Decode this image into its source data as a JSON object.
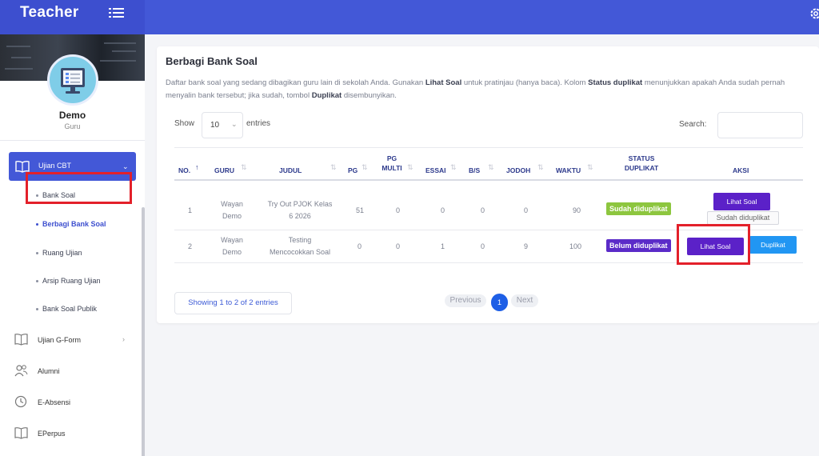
{
  "app": {
    "title": "Teacher"
  },
  "profile": {
    "name": "Demo",
    "role": "Guru"
  },
  "sidebar": {
    "active_menu": {
      "label": "Ujian CBT",
      "icon": "book-open-icon"
    },
    "submenu": [
      {
        "label": "Bank Soal"
      },
      {
        "label": "Berbagi Bank Soal"
      },
      {
        "label": "Ruang Ujian"
      },
      {
        "label": "Arsip Ruang Ujian"
      },
      {
        "label": "Bank Soal Publik"
      }
    ],
    "menu": [
      {
        "label": "Ujian G-Form",
        "icon": "book-icon"
      },
      {
        "label": "Alumni",
        "icon": "users-icon"
      },
      {
        "label": "E-Absensi",
        "icon": "clock-icon"
      },
      {
        "label": "EPerpus",
        "icon": "book-icon"
      }
    ]
  },
  "page": {
    "title": "Berbagi Bank Soal",
    "desc": {
      "p1": "Daftar bank soal yang sedang dibagikan guru lain di sekolah Anda. Gunakan ",
      "b1": "Lihat Soal",
      "p2": " untuk pratinjau (hanya baca). Kolom ",
      "b2": "Status duplikat",
      "p3": " menunjukkan apakah Anda sudah pernah menyalin bank tersebut; jika sudah, tombol ",
      "b3": "Duplikat",
      "p4": " disembunyikan."
    }
  },
  "table_controls": {
    "show_label": "Show",
    "show_value": "10",
    "entries_label": "entries",
    "search_label": "Search:"
  },
  "table": {
    "headers": {
      "no": "NO.",
      "guru": "GURU",
      "judul": "JUDUL",
      "pg": "PG",
      "pg_multi_1": "PG",
      "pg_multi_2": "MULTI",
      "essai": "ESSAI",
      "bs": "B/S",
      "jodoh": "JODOH",
      "waktu": "WAKTU",
      "status_1": "STATUS",
      "status_2": "DUPLIKAT",
      "aksi": "AKSI"
    },
    "rows": [
      {
        "no": "1",
        "guru_1": "Wayan",
        "guru_2": "Demo",
        "judul_1": "Try Out PJOK Kelas",
        "judul_2": "6 2026",
        "pg": "51",
        "pg_multi": "0",
        "essai": "0",
        "bs": "0",
        "jodoh": "0",
        "waktu": "90",
        "status": "Sudah diduplikat",
        "status_color": "#8dc63f",
        "view_label": "Lihat Soal",
        "dup_label": "Sudah diduplikat"
      },
      {
        "no": "2",
        "guru_1": "Wayan",
        "guru_2": "Demo",
        "judul_1": "Testing",
        "judul_2": "Mencocokkan Soal",
        "pg": "0",
        "pg_multi": "0",
        "essai": "1",
        "bs": "0",
        "jodoh": "9",
        "waktu": "100",
        "status": "Belum diduplikat",
        "status_color": "#5b2bc8",
        "view_label": "Lihat Soal",
        "dup_label": "Duplikat"
      }
    ]
  },
  "footer": {
    "showing": "Showing 1 to 2 of 2 entries",
    "prev": "Previous",
    "page": "1",
    "next": "Next"
  },
  "colors": {
    "primary": "#4358d7",
    "purple": "#5b21c8",
    "cyan": "#2196f3",
    "green": "#8dc63f",
    "highlight": "#e3202a"
  }
}
